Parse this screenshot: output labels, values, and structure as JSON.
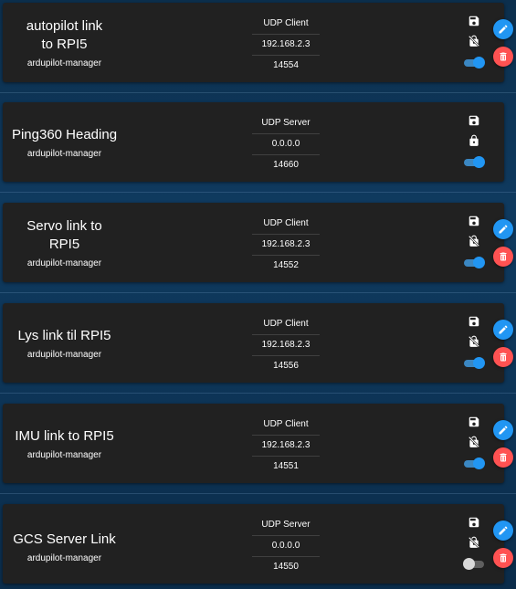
{
  "endpoints": [
    {
      "name": "autopilot link to RPI5",
      "owner": "ardupilot-manager",
      "type": "UDP Client",
      "ip": "192.168.2.3",
      "port": "14554",
      "persistent_icon": "save-icon",
      "protection_icon": "lock-off-icon",
      "enabled": true,
      "editable": true
    },
    {
      "name": "Ping360 Heading",
      "owner": "ardupilot-manager",
      "type": "UDP Server",
      "ip": "0.0.0.0",
      "port": "14660",
      "persistent_icon": "save-icon",
      "protection_icon": "lock-icon",
      "enabled": true,
      "editable": false
    },
    {
      "name": "Servo link to RPI5",
      "owner": "ardupilot-manager",
      "type": "UDP Client",
      "ip": "192.168.2.3",
      "port": "14552",
      "persistent_icon": "save-icon",
      "protection_icon": "lock-off-icon",
      "enabled": true,
      "editable": true
    },
    {
      "name": "Lys link til RPI5",
      "owner": "ardupilot-manager",
      "type": "UDP Client",
      "ip": "192.168.2.3",
      "port": "14556",
      "persistent_icon": "save-icon",
      "protection_icon": "lock-off-icon",
      "enabled": true,
      "editable": true
    },
    {
      "name": "IMU link to RPI5",
      "owner": "ardupilot-manager",
      "type": "UDP Client",
      "ip": "192.168.2.3",
      "port": "14551",
      "persistent_icon": "save-icon",
      "protection_icon": "lock-off-icon",
      "enabled": true,
      "editable": true
    },
    {
      "name": "GCS Server Link",
      "owner": "ardupilot-manager",
      "type": "UDP Server",
      "ip": "0.0.0.0",
      "port": "14550",
      "persistent_icon": "save-icon",
      "protection_icon": "lock-off-icon",
      "enabled": false,
      "editable": true
    }
  ],
  "colors": {
    "card_bg": "#212121",
    "page_bg": "#0f3a5f",
    "toggle_on": "#2196f3",
    "toggle_off": "#d9d9d9",
    "edit_button": "#2196f3",
    "delete_button": "#ff5252"
  }
}
